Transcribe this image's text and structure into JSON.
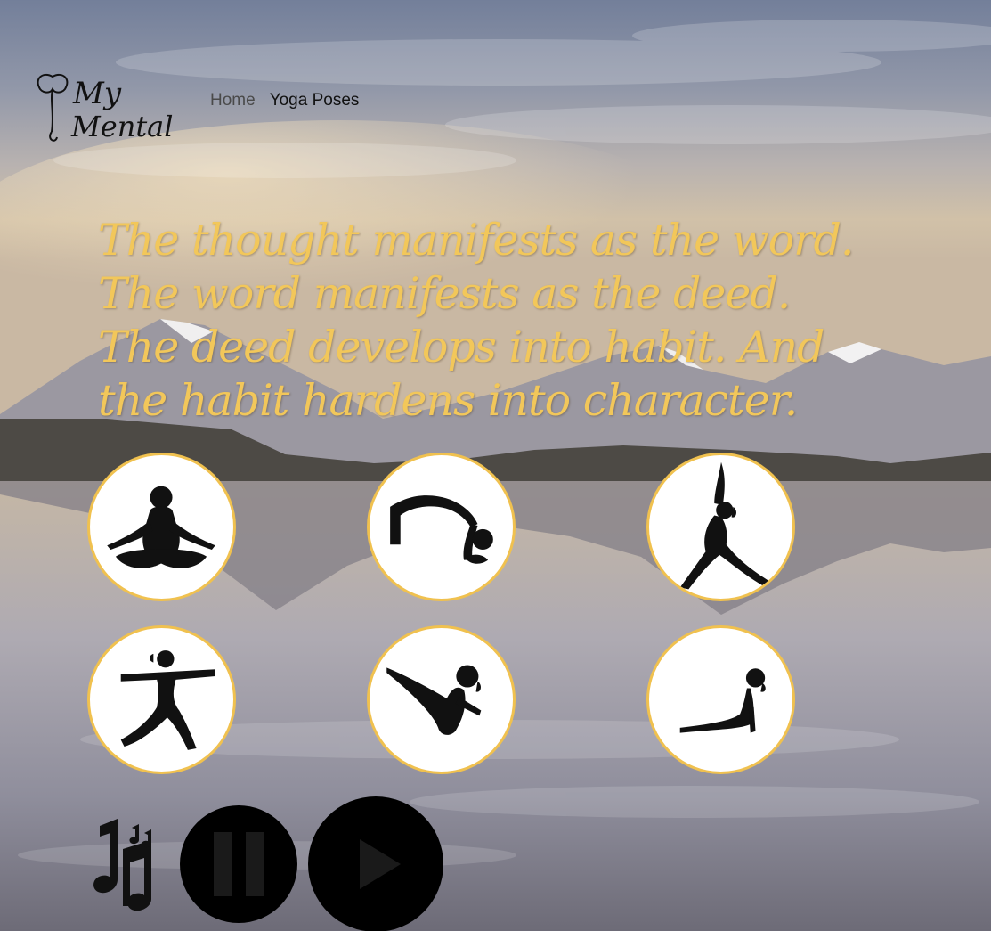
{
  "logo": {
    "line1": "My",
    "line2": "Mental",
    "icon": "flower-icon"
  },
  "nav": {
    "items": [
      {
        "label": "Home"
      },
      {
        "label": "Yoga Poses"
      }
    ]
  },
  "quote": {
    "text": "The thought manifests as the word. The word manifests as the deed. The deed develops into habit. And the habit hardens into character."
  },
  "poses": [
    {
      "icon": "lotus-pose-icon"
    },
    {
      "icon": "bridge-pose-icon"
    },
    {
      "icon": "crescent-lunge-pose-icon"
    },
    {
      "icon": "warrior-pose-icon"
    },
    {
      "icon": "boat-pose-icon"
    },
    {
      "icon": "cobra-pose-icon"
    }
  ],
  "audio_controls": {
    "music": "music-notes-icon",
    "pause": "pause-icon",
    "play": "play-icon"
  },
  "colors": {
    "accent": "#f2c75a",
    "border": "#f0c14f",
    "sky_top": "#7f8ca7",
    "water": "#8a8997"
  }
}
